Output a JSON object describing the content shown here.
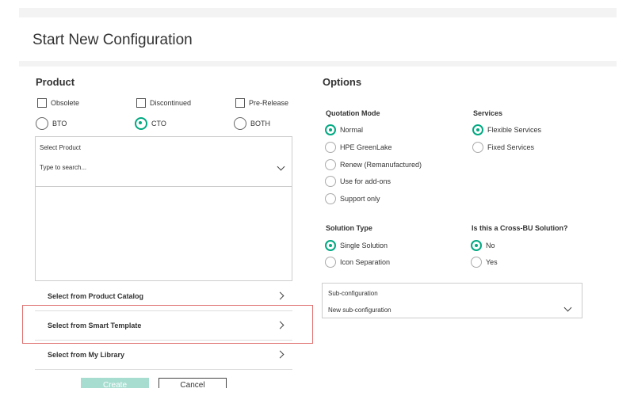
{
  "header": {
    "title": "Start New Configuration"
  },
  "product": {
    "title": "Product",
    "checkboxes": [
      {
        "label": "Obsolete",
        "checked": false
      },
      {
        "label": "Discontinued",
        "checked": false
      },
      {
        "label": "Pre-Release",
        "checked": false
      }
    ],
    "build_types": [
      {
        "label": "BTO",
        "selected": false
      },
      {
        "label": "CTO",
        "selected": true
      },
      {
        "label": "BOTH",
        "selected": false
      }
    ],
    "select_product": {
      "label": "Select Product",
      "placeholder": "Type to search..."
    },
    "links": [
      {
        "label": "Select from Product Catalog"
      },
      {
        "label": "Select from Smart Template"
      },
      {
        "label": "Select from My Library"
      }
    ],
    "buttons": {
      "create": "Create",
      "cancel": "Cancel"
    }
  },
  "options": {
    "title": "Options",
    "quotation_mode": {
      "title": "Quotation Mode",
      "items": [
        {
          "label": "Normal",
          "selected": true
        },
        {
          "label": "HPE GreenLake",
          "selected": false
        },
        {
          "label": "Renew (Remanufactured)",
          "selected": false
        },
        {
          "label": "Use for add-ons",
          "selected": false
        },
        {
          "label": "Support only",
          "selected": false
        }
      ]
    },
    "services": {
      "title": "Services",
      "items": [
        {
          "label": "Flexible Services",
          "selected": true
        },
        {
          "label": "Fixed Services",
          "selected": false
        }
      ]
    },
    "solution_type": {
      "title": "Solution Type",
      "items": [
        {
          "label": "Single Solution",
          "selected": true
        },
        {
          "label": "Icon Separation",
          "selected": false
        }
      ]
    },
    "cross_bu": {
      "title": "Is this a Cross-BU Solution?",
      "items": [
        {
          "label": "No",
          "selected": true
        },
        {
          "label": "Yes",
          "selected": false
        }
      ]
    },
    "sub_configuration": {
      "label": "Sub-configuration",
      "value": "New sub-configuration"
    }
  },
  "colors": {
    "accent": "#01a982",
    "highlight": "#e07070",
    "create_disabled": "#a7ddd0"
  }
}
